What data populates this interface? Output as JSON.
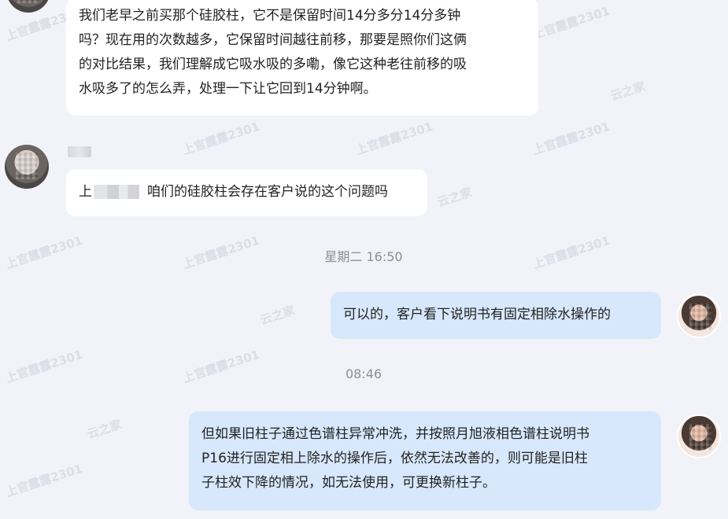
{
  "watermarks": [
    {
      "text": "上官露露2301"
    },
    {
      "text": "上官露露2301"
    },
    {
      "text": "上官露露2301"
    },
    {
      "text": "上官露露2301"
    },
    {
      "text": "上官露露2301"
    },
    {
      "text": "上官露露2301"
    },
    {
      "text": "上官露露2301"
    },
    {
      "text": "上官露露2301"
    },
    {
      "text": "上官露露2301"
    },
    {
      "text": "上官露露2301"
    },
    {
      "text": "上官露露2301"
    },
    {
      "text": "上官露露2301"
    },
    {
      "text": "云之家"
    },
    {
      "text": "云之家"
    },
    {
      "text": "云之家"
    },
    {
      "text": "云之家"
    }
  ],
  "messages": {
    "m1": {
      "lines": [
        "我们老早之前买那个硅胶柱，它不是保留时间14分多分14分多钟",
        "吗？现在用的次数越多，它保留时间越往前移，那要是照你们这俩",
        "的对比结果，我们理解成它吸水吸的多嘞，像它这种老往前移的吸",
        "水吸多了的怎么弄，处理一下让它回到14分钟啊。"
      ]
    },
    "m2": {
      "prefix": "上",
      "text": "咱们的硅胶柱会存在客户说的这个问题吗"
    },
    "t1": "星期二 16:50",
    "m3": {
      "text": "可以的，客户看下说明书有固定相除水操作的"
    },
    "t2": "08:46",
    "m4": {
      "lines": [
        "但如果旧柱子通过色谱柱异常冲洗，并按照月旭液相色谱柱说明书",
        "P16进行固定相上除水的操作后，依然无法改善的，则可能是旧柱",
        "子柱效下降的情况，如无法使用，可更换新柱子。"
      ]
    }
  }
}
